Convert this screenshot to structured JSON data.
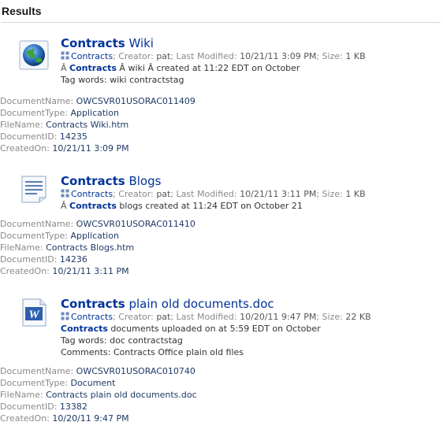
{
  "header": {
    "title": "Results"
  },
  "results": [
    {
      "icon": "globe-icon",
      "title_bold": "Contracts",
      "title_rest": " Wiki",
      "meta_site": "Contracts",
      "meta_creator_label": "; Creator: ",
      "meta_creator": "pat",
      "meta_modified_label": "; Last Modified: ",
      "meta_modified": "10/21/11 3:09 PM",
      "meta_size_label": "; Size: ",
      "meta_size": "1 KB",
      "desc_prefix": "Â ",
      "desc_bold": "Contracts",
      "desc_rest": " Â wiki Â created at 11:22 EDT on October",
      "tag_words": "Tag words: wiki contractstag",
      "props": {
        "DocumentName": "OWCSVR01USORAC011409",
        "DocumentType": "Application",
        "FileName": "Contracts Wiki.htm",
        "DocumentID": "14235",
        "CreatedOn": "10/21/11 3:09 PM"
      }
    },
    {
      "icon": "document-lines-icon",
      "title_bold": "Contracts",
      "title_rest": " Blogs",
      "meta_site": "Contracts",
      "meta_creator_label": "; Creator: ",
      "meta_creator": "pat",
      "meta_modified_label": "; Last Modified: ",
      "meta_modified": "10/21/11 3:11 PM",
      "meta_size_label": "; Size: ",
      "meta_size": "1 KB",
      "desc_prefix": "Â ",
      "desc_bold": "Contracts",
      "desc_rest": " blogs created at 11:24 EDT on October 21",
      "props": {
        "DocumentName": "OWCSVR01USORAC011410",
        "DocumentType": "Application",
        "FileName": "Contracts Blogs.htm",
        "DocumentID": "14236",
        "CreatedOn": "10/21/11 3:11 PM"
      }
    },
    {
      "icon": "word-document-icon",
      "title_bold": "Contracts",
      "title_rest": " plain old documents.doc",
      "meta_site": "Contracts",
      "meta_creator_label": "; Creator: ",
      "meta_creator": "pat",
      "meta_modified_label": "; Last Modified: ",
      "meta_modified": "10/20/11 9:47 PM",
      "meta_size_label": "; Size: ",
      "meta_size": "22 KB",
      "desc_prefix": "",
      "desc_bold": "Contracts",
      "desc_rest": " documents uploaded on at 5:59 EDT on October",
      "tag_words": "Tag words: doc contractstag",
      "comments": "Comments: Contracts Office plain old files",
      "props": {
        "DocumentName": "OWCSVR01USORAC010740",
        "DocumentType": "Document",
        "FileName": "Contracts plain old documents.doc",
        "DocumentID": "13382",
        "CreatedOn": "10/20/11 9:47 PM"
      }
    }
  ],
  "labels": {
    "DocumentName": "DocumentName: ",
    "DocumentType": "DocumentType: ",
    "FileName": "FileName: ",
    "DocumentID": "DocumentID: ",
    "CreatedOn": "CreatedOn: "
  }
}
